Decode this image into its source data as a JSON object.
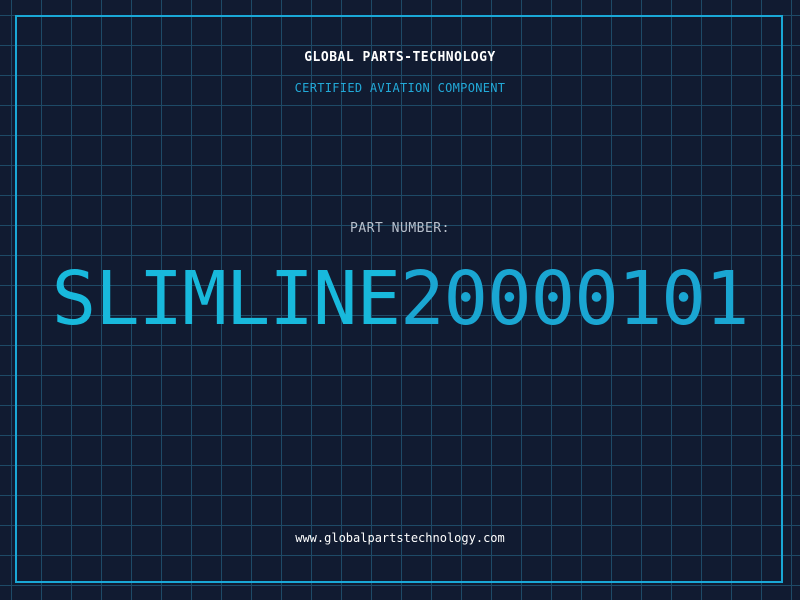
{
  "header": {
    "company": "GLOBAL PARTS-TECHNOLOGY",
    "tagline": "CERTIFIED AVIATION COMPONENT"
  },
  "part": {
    "label": "PART NUMBER:",
    "prefix": "SLIMLINE",
    "number": "20000101"
  },
  "footer": {
    "website": "www.globalpartstechnology.com"
  },
  "colors": {
    "background": "#111b31",
    "grid": "#1e4a66",
    "accent": "#1aa8d6"
  }
}
